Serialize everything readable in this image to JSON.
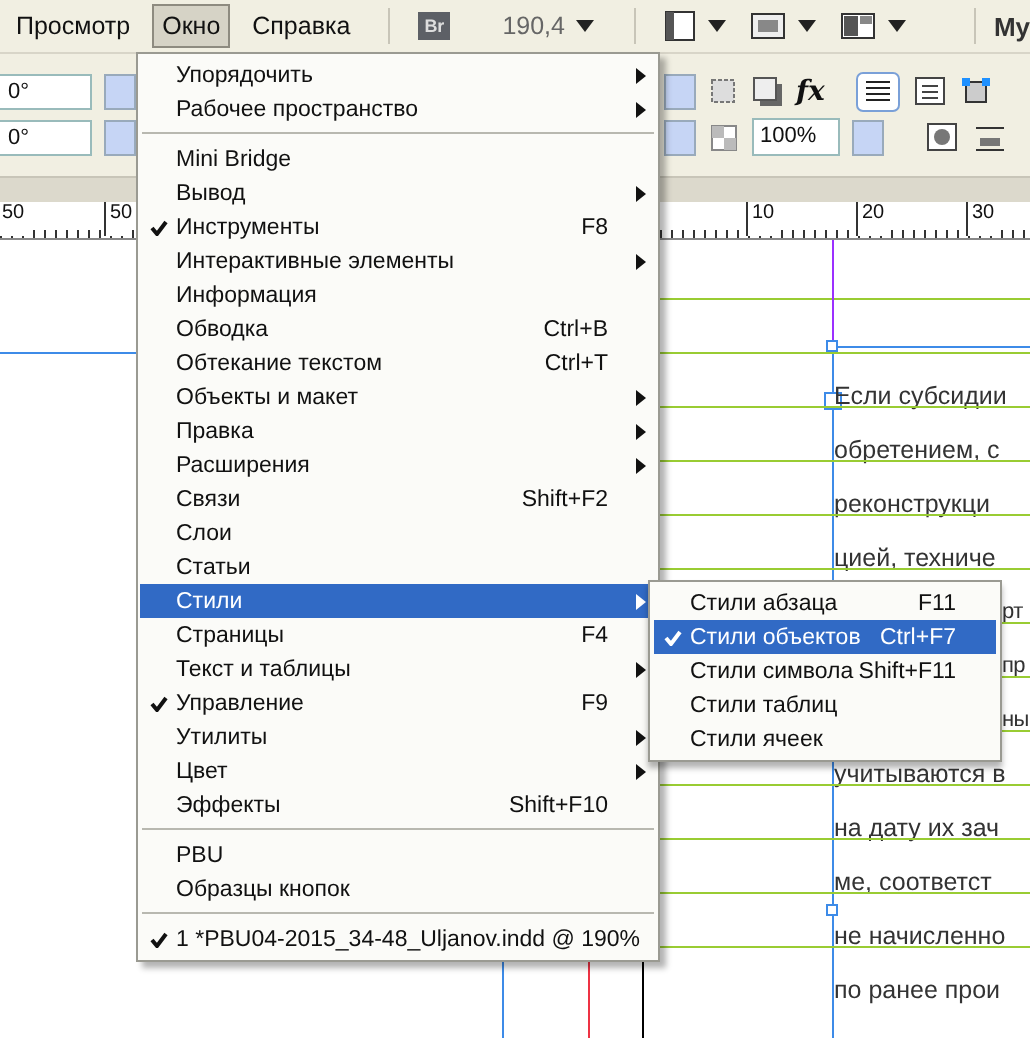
{
  "menubar": [
    {
      "label": "Просмотр",
      "selected": false
    },
    {
      "label": "Окно",
      "selected": true
    },
    {
      "label": "Справка",
      "selected": false
    }
  ],
  "toolbar": {
    "bridge": "Br",
    "zoom": "190,4",
    "workspace": "My"
  },
  "control_panel": {
    "effects": "fx",
    "rotate": "0°",
    "shear": "0°",
    "opacity": "100%"
  },
  "ruler": {
    "left_labels": [
      "50",
      "50"
    ],
    "right_labels": [
      "10",
      "20",
      "30"
    ]
  },
  "menu": {
    "items": [
      {
        "kind": "item",
        "label": "Упорядочить",
        "submenu": true,
        "checked": false,
        "selected": false
      },
      {
        "kind": "item",
        "label": "Рабочее пространство",
        "submenu": true,
        "checked": false,
        "selected": false
      },
      {
        "kind": "separator"
      },
      {
        "kind": "item",
        "label": "Mini Bridge",
        "submenu": false,
        "checked": false,
        "selected": false
      },
      {
        "kind": "item",
        "label": "Вывод",
        "submenu": true,
        "checked": false,
        "selected": false
      },
      {
        "kind": "item",
        "label": "Инструменты",
        "shortcut": "F8",
        "submenu": false,
        "checked": true,
        "selected": false
      },
      {
        "kind": "item",
        "label": "Интерактивные элементы",
        "submenu": true,
        "checked": false,
        "selected": false
      },
      {
        "kind": "item",
        "label": "Информация",
        "submenu": false,
        "checked": false,
        "selected": false
      },
      {
        "kind": "item",
        "label": "Обводка",
        "shortcut": "Ctrl+B",
        "submenu": false,
        "checked": false,
        "selected": false
      },
      {
        "kind": "item",
        "label": "Обтекание текстом",
        "shortcut": "Ctrl+T",
        "submenu": false,
        "checked": false,
        "selected": false
      },
      {
        "kind": "item",
        "label": "Объекты и макет",
        "submenu": true,
        "checked": false,
        "selected": false
      },
      {
        "kind": "item",
        "label": "Правка",
        "submenu": true,
        "checked": false,
        "selected": false
      },
      {
        "kind": "item",
        "label": "Расширения",
        "submenu": true,
        "checked": false,
        "selected": false
      },
      {
        "kind": "item",
        "label": "Связи",
        "shortcut": "Shift+F2",
        "submenu": false,
        "checked": false,
        "selected": false
      },
      {
        "kind": "item",
        "label": "Слои",
        "submenu": false,
        "checked": false,
        "selected": false
      },
      {
        "kind": "item",
        "label": "Статьи",
        "submenu": false,
        "checked": false,
        "selected": false
      },
      {
        "kind": "item",
        "label": "Стили",
        "submenu": true,
        "checked": false,
        "selected": true
      },
      {
        "kind": "item",
        "label": "Страницы",
        "shortcut": "F4",
        "submenu": false,
        "checked": false,
        "selected": false
      },
      {
        "kind": "item",
        "label": "Текст и таблицы",
        "submenu": true,
        "checked": false,
        "selected": false
      },
      {
        "kind": "item",
        "label": "Управление",
        "shortcut": "F9",
        "submenu": false,
        "checked": true,
        "selected": false
      },
      {
        "kind": "item",
        "label": "Утилиты",
        "submenu": true,
        "checked": false,
        "selected": false
      },
      {
        "kind": "item",
        "label": "Цвет",
        "submenu": true,
        "checked": false,
        "selected": false
      },
      {
        "kind": "item",
        "label": "Эффекты",
        "shortcut": "Shift+F10",
        "submenu": false,
        "checked": false,
        "selected": false
      },
      {
        "kind": "separator"
      },
      {
        "kind": "item",
        "label": "PBU",
        "submenu": false,
        "checked": false,
        "selected": false
      },
      {
        "kind": "item",
        "label": "Образцы кнопок",
        "submenu": false,
        "checked": false,
        "selected": false
      },
      {
        "kind": "separator"
      },
      {
        "kind": "item",
        "label": "1 *PBU04-2015_34-48_Uljanov.indd @ 190%",
        "submenu": false,
        "checked": true,
        "selected": false
      }
    ]
  },
  "submenu": {
    "items": [
      {
        "label": "Стили абзаца",
        "shortcut": "F11",
        "checked": false,
        "selected": false
      },
      {
        "label": "Стили объектов",
        "shortcut": "Ctrl+F7",
        "checked": true,
        "selected": true
      },
      {
        "label": "Стили символа",
        "shortcut": "Shift+F11",
        "checked": false,
        "selected": false
      },
      {
        "label": "Стили таблиц",
        "checked": false,
        "selected": false
      },
      {
        "label": "Стили ячеек",
        "checked": false,
        "selected": false
      }
    ]
  },
  "document": {
    "lines": [
      {
        "kind": "full",
        "text": "Если субсидии"
      },
      {
        "kind": "full",
        "text": "обретением, с"
      },
      {
        "kind": "full",
        "text": "реконструкци"
      },
      {
        "kind": "full",
        "text": "цией, техниче"
      },
      {
        "kind": "fragment",
        "text": "рт"
      },
      {
        "kind": "fragment",
        "text": "пр"
      },
      {
        "kind": "fragment",
        "text": "ны"
      },
      {
        "kind": "full",
        "text": "учитываются в"
      },
      {
        "kind": "full",
        "text": "на дату их зач"
      },
      {
        "kind": "full",
        "text": "ме, соответст"
      },
      {
        "kind": "full",
        "text": "не начисленно"
      },
      {
        "kind": "full",
        "text": "по ранее прои"
      }
    ]
  }
}
